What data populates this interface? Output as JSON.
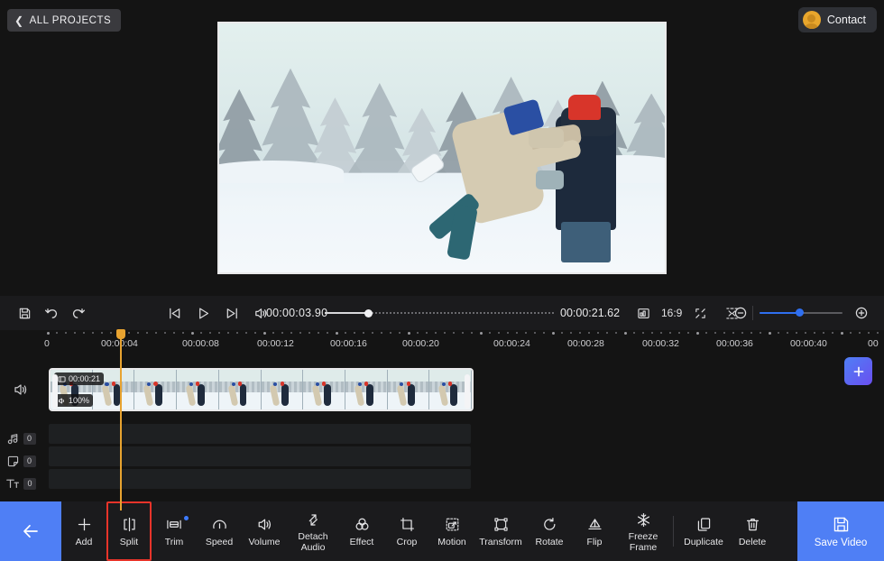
{
  "header": {
    "all_projects_label": "ALL PROJECTS",
    "back_chevron_icon": "chevron-left-icon",
    "contact_label": "Contact",
    "avatar_icon": "user-avatar-icon"
  },
  "preview": {
    "scene_description": "Couple embracing in snowy forest"
  },
  "controls": {
    "save_icon": "save-icon",
    "undo_icon": "undo-icon",
    "redo_icon": "redo-icon",
    "prev_frame_icon": "skip-previous-icon",
    "play_icon": "play-icon",
    "next_frame_icon": "skip-next-icon",
    "volume_icon": "volume-icon",
    "current_time": "00:00:03.90",
    "total_time": "00:00:21.62",
    "progress_percent": 19,
    "aspect_icon": "aspect-ratio-icon",
    "aspect_ratio": "16:9",
    "fullscreen_icon": "fullscreen-icon",
    "fit_icon": "fit-to-screen-icon",
    "zoom_out_icon": "zoom-out-icon",
    "zoom_in_icon": "zoom-in-icon",
    "zoom_percent": 48
  },
  "timeline": {
    "playhead_time": "00:00:03.90",
    "ruler_labels": [
      "0",
      "00:00:04",
      "00:00:08",
      "00:00:12",
      "00:00:16",
      "00:00:20",
      "00:00:24",
      "00:00:28",
      "00:00:32",
      "00:00:36",
      "00:00:40",
      "00"
    ],
    "video_track": {
      "mute_icon": "volume-icon",
      "clip_duration_badge": "00:00:21",
      "clip_duration_icon": "clip-icon",
      "clip_volume_badge": "100%",
      "clip_volume_icon": "volume-small-icon"
    },
    "tracks": [
      {
        "icon": "music-note-icon",
        "name": "audio-track",
        "count": "0"
      },
      {
        "icon": "sticker-icon",
        "name": "overlay-track",
        "count": "0"
      },
      {
        "icon": "text-icon",
        "name": "text-track",
        "count": "0"
      }
    ],
    "add_media_icon": "plus-icon"
  },
  "toolbar": {
    "back_icon": "arrow-left-icon",
    "items": [
      {
        "label": "Add",
        "icon": "plus-icon",
        "active": false,
        "badge": false
      },
      {
        "label": "Split",
        "icon": "split-icon",
        "active": true,
        "badge": false
      },
      {
        "label": "Trim",
        "icon": "trim-icon",
        "active": false,
        "badge": true
      },
      {
        "label": "Speed",
        "icon": "speed-icon",
        "active": false,
        "badge": false
      },
      {
        "label": "Volume",
        "icon": "volume-icon",
        "active": false,
        "badge": false
      },
      {
        "label": "Detach\nAudio",
        "icon": "detach-audio-icon",
        "active": false,
        "badge": false
      },
      {
        "label": "Effect",
        "icon": "effect-icon",
        "active": false,
        "badge": false
      },
      {
        "label": "Crop",
        "icon": "crop-icon",
        "active": false,
        "badge": false
      },
      {
        "label": "Motion",
        "icon": "motion-icon",
        "active": false,
        "badge": false
      },
      {
        "label": "Transform",
        "icon": "transform-icon",
        "active": false,
        "badge": false
      },
      {
        "label": "Rotate",
        "icon": "rotate-icon",
        "active": false,
        "badge": false
      },
      {
        "label": "Flip",
        "icon": "flip-icon",
        "active": false,
        "badge": false
      },
      {
        "label": "Freeze\nFrame",
        "icon": "freeze-frame-icon",
        "active": false,
        "badge": false
      },
      {
        "label": "Duplicate",
        "icon": "duplicate-icon",
        "active": false,
        "badge": false
      },
      {
        "label": "Delete",
        "icon": "trash-icon",
        "active": false,
        "badge": false
      }
    ],
    "save_video_label": "Save Video",
    "save_video_icon": "save-icon"
  },
  "colors": {
    "accent_blue": "#4f7ff5",
    "playhead_orange": "#e8a330",
    "highlight_red": "#e8342a",
    "avatar_gold": "#e8a62c"
  }
}
